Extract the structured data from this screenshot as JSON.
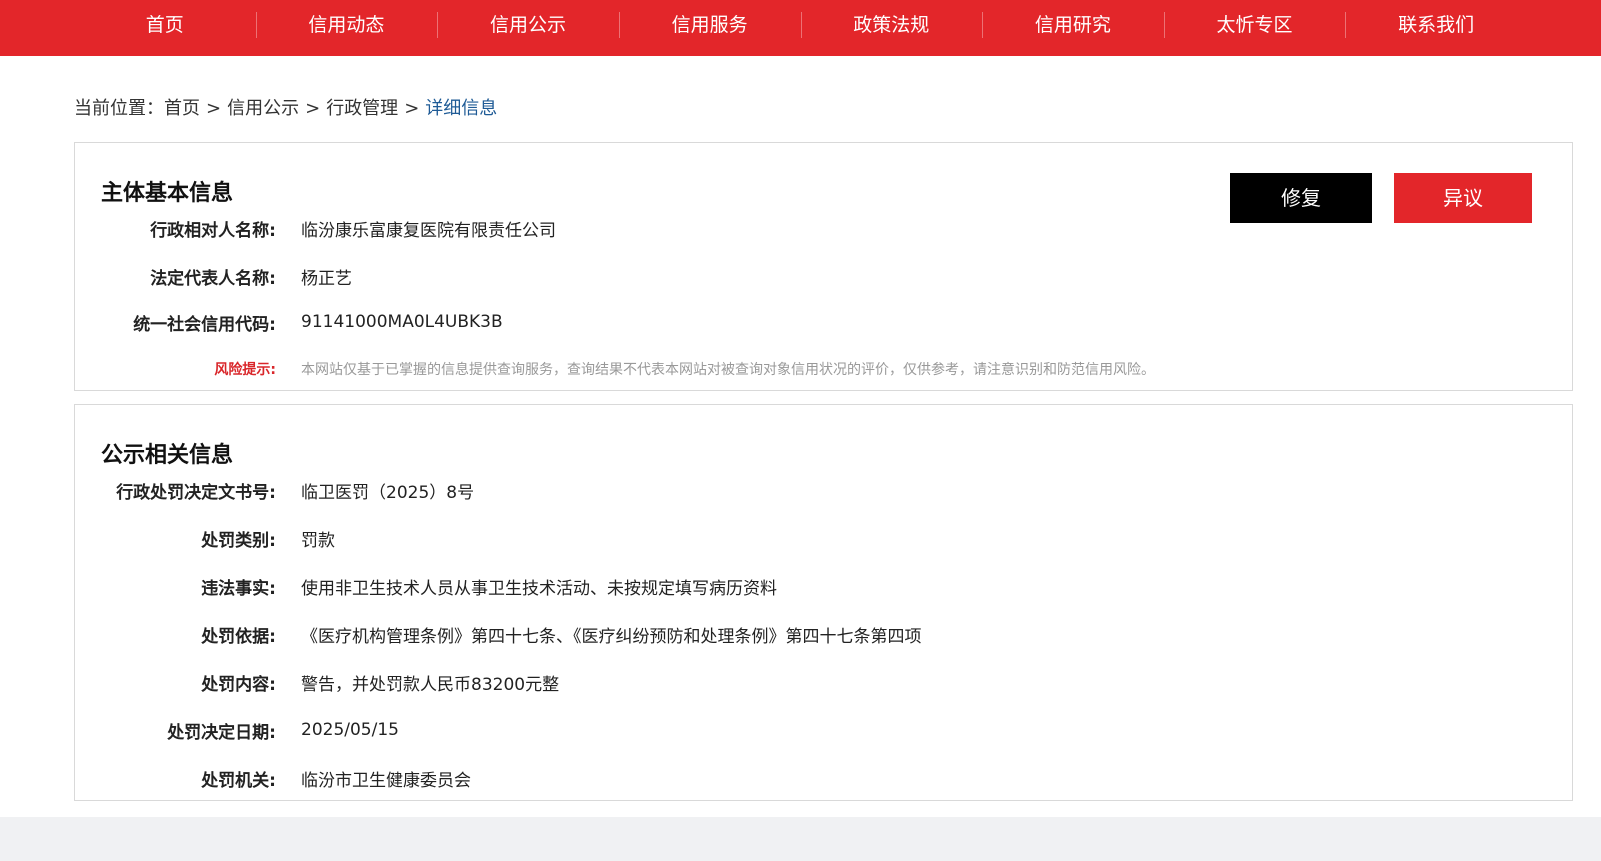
{
  "nav": {
    "items": [
      "首页",
      "信用动态",
      "信用公示",
      "信用服务",
      "政策法规",
      "信用研究",
      "太忻专区",
      "联系我们"
    ]
  },
  "breadcrumb": {
    "prefix": "当前位置：",
    "items": [
      "首页",
      "信用公示",
      "行政管理"
    ],
    "separator": ">",
    "current": "详细信息"
  },
  "basic_info": {
    "title": "主体基本信息",
    "repair_label": "修复",
    "objection_label": "异议",
    "fields": [
      {
        "label": "行政相对人名称:",
        "value": "临汾康乐富康复医院有限责任公司"
      },
      {
        "label": "法定代表人名称:",
        "value": "杨正艺"
      },
      {
        "label": "统一社会信用代码:",
        "value": "91141000MA0L4UBK3B"
      }
    ],
    "risk": {
      "label": "风险提示:",
      "value": "本网站仅基于已掌握的信息提供查询服务，查询结果不代表本网站对被查询对象信用状况的评价，仅供参考，请注意识别和防范信用风险。"
    }
  },
  "public_info": {
    "title": "公示相关信息",
    "fields": [
      {
        "label": "行政处罚决定文书号:",
        "value": "临卫医罚（2025）8号"
      },
      {
        "label": "处罚类别:",
        "value": "罚款"
      },
      {
        "label": "违法事实:",
        "value": "使用非卫生技术人员从事卫生技术活动、未按规定填写病历资料"
      },
      {
        "label": "处罚依据:",
        "value": "《医疗机构管理条例》第四十七条、《医疗纠纷预防和处理条例》第四十七条第四项"
      },
      {
        "label": "处罚内容:",
        "value": "警告，并处罚款人民币83200元整"
      },
      {
        "label": "处罚决定日期:",
        "value": "2025/05/15"
      },
      {
        "label": "处罚机关:",
        "value": "临汾市卫生健康委员会"
      }
    ]
  },
  "colors": {
    "brand_red": "#e3262a",
    "link_blue": "#1f5b96"
  }
}
